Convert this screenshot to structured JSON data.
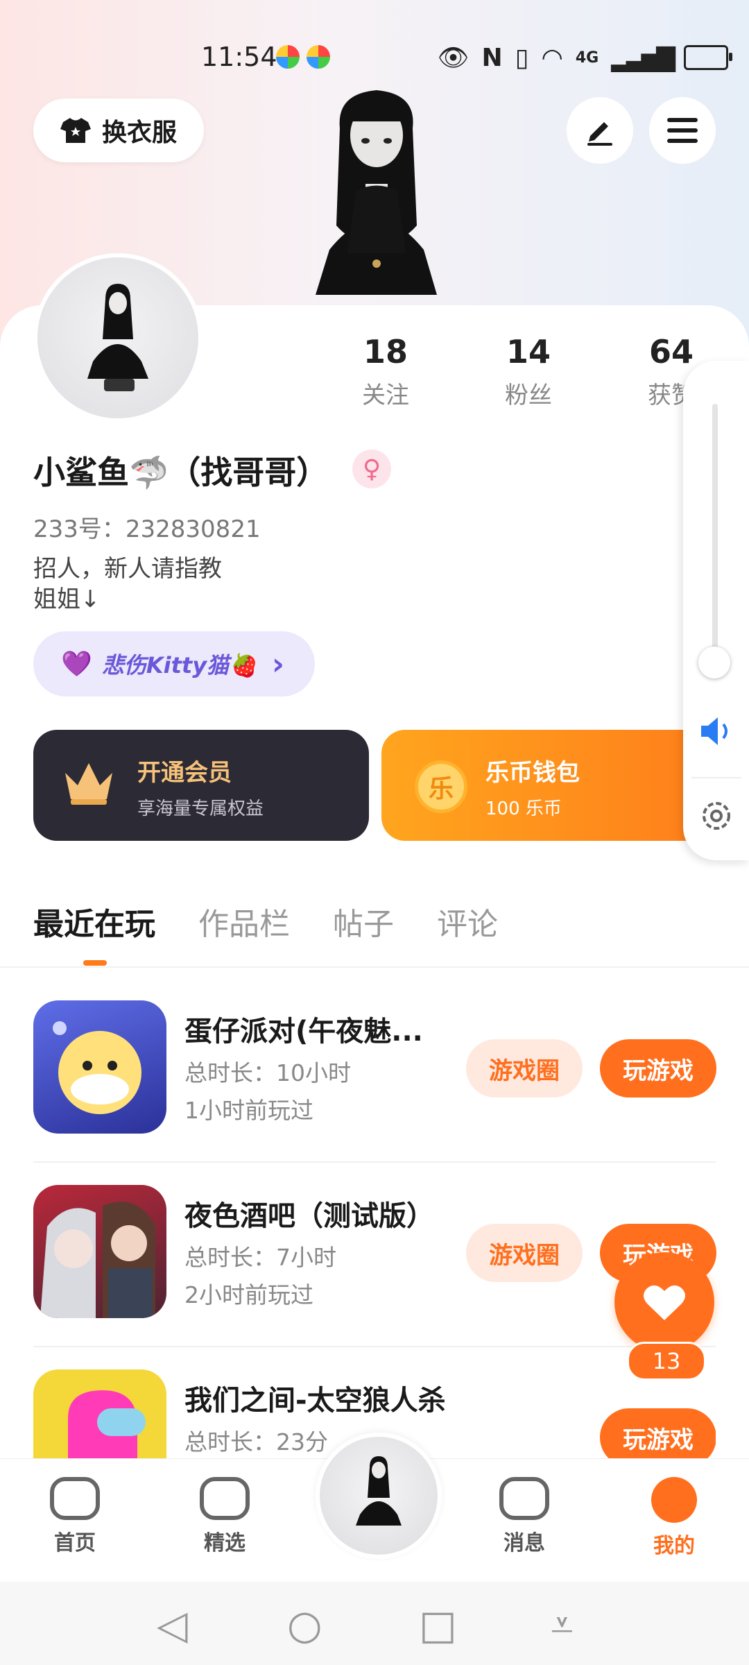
{
  "status_bar": {
    "time": "11:54",
    "icons": [
      "app-icon-1",
      "app-icon-2",
      "eye-icon",
      "nfc-icon",
      "vibrate-icon",
      "wifi-icon",
      "signal-4g-icon",
      "battery-charging-icon"
    ],
    "network_label": "4G"
  },
  "header": {
    "outfit_button_label": "换衣服",
    "edit_icon": "edit-icon",
    "menu_icon": "menu-icon"
  },
  "profile": {
    "stats": [
      {
        "value": "18",
        "label": "关注"
      },
      {
        "value": "14",
        "label": "粉丝"
      },
      {
        "value": "64",
        "label": "获赞"
      }
    ],
    "name": "小鲨鱼🦈（找哥哥）",
    "gender_icon": "female-icon",
    "id_text": "233号：232830821",
    "bio": "招人，新人请指教\n姐姐↓",
    "fan_tag": {
      "heart": "💜",
      "label": "悲伤Kitty猫🍓",
      "chevron": "›"
    }
  },
  "promo": {
    "vip": {
      "title": "开通会员",
      "subtitle": "享海量专属权益",
      "icon": "crown-icon",
      "color": "#f6c27a"
    },
    "wallet": {
      "title": "乐币钱包",
      "subtitle": "100 乐币",
      "coin_char": "乐"
    }
  },
  "side_panel": {
    "volume_icon": "volume-icon",
    "settings_icon": "settings-icon"
  },
  "tabs": [
    {
      "label": "最近在玩",
      "active": true
    },
    {
      "label": "作品栏",
      "active": false
    },
    {
      "label": "帖子",
      "active": false
    },
    {
      "label": "评论",
      "active": false
    }
  ],
  "games": [
    {
      "title": "蛋仔派对(午夜魅...",
      "duration": "总时长：10小时",
      "last_played": "1小时前玩过",
      "circle_label": "游戏圈",
      "play_label": "玩游戏"
    },
    {
      "title": "夜色酒吧（测试版）",
      "duration": "总时长：7小时",
      "last_played": "2小时前玩过",
      "circle_label": "游戏圈",
      "play_label": "玩游戏"
    },
    {
      "title": "我们之间-太空狼人杀",
      "duration": "总时长：23分",
      "play_label": "玩游戏"
    }
  ],
  "like_fab": {
    "count": "13"
  },
  "bottom_nav": [
    {
      "label": "首页"
    },
    {
      "label": "精选"
    },
    {
      "label": "消息"
    },
    {
      "label": "我的",
      "active": true
    }
  ],
  "colors": {
    "accent": "#ff6f1e",
    "vip_bg": "#2c2a35",
    "tag_purple": "#6b57d9"
  }
}
